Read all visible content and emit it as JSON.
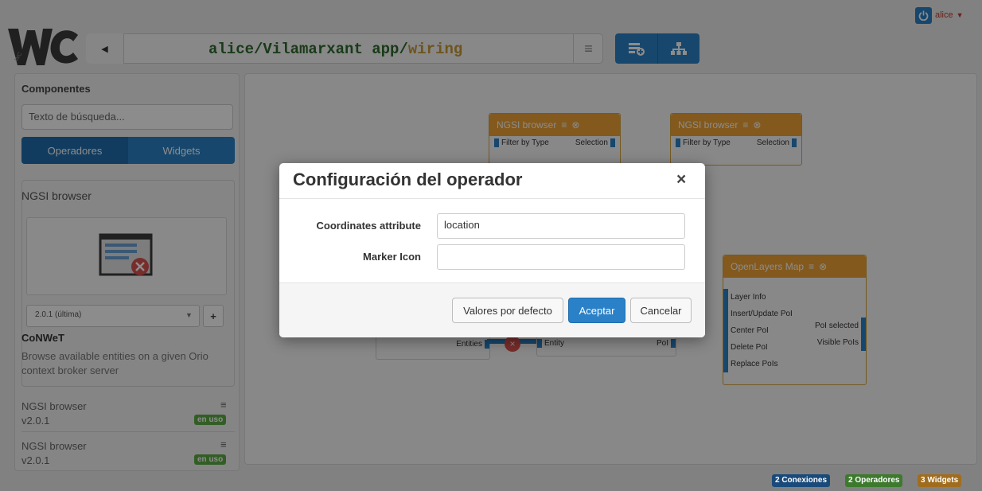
{
  "header": {
    "logo_text": "WC",
    "breadcrumb": {
      "user": "alice",
      "workspace": "Vilamarxant app",
      "view": "wiring",
      "separator": "/"
    },
    "user": {
      "name": "alice"
    }
  },
  "sidebar": {
    "title": "Componentes",
    "search_placeholder": "Texto de búsqueda...",
    "tabs": [
      {
        "label": "Operadores",
        "active": true
      },
      {
        "label": "Widgets",
        "active": false
      }
    ],
    "selected": {
      "name": "NGSI browser",
      "version": "2.0.1 (última)",
      "vendor": "CoNWeT",
      "description": "Browse available entities on a given Orio context broker server"
    },
    "instances": [
      {
        "name": "NGSI browser",
        "version": "v2.0.1",
        "badge": "en uso"
      },
      {
        "name": "NGSI browser",
        "version": "v2.0.1",
        "badge": "en uso"
      }
    ]
  },
  "canvas": {
    "operators": [
      {
        "title": "NGSI browser",
        "inputs": [
          "Filter by Type"
        ],
        "outputs": [
          "Selection"
        ]
      },
      {
        "title": "NGSI browser",
        "inputs": [
          "Filter by Type"
        ],
        "outputs": [
          "Selection"
        ]
      },
      {
        "title": "OpenLayers Map",
        "inputs": [
          "Layer Info",
          "Insert/Update PoI",
          "Center PoI",
          "Delete PoI",
          "Replace PoIs"
        ],
        "outputs": [
          "PoI selected",
          "Visible PoIs"
        ]
      }
    ],
    "fragments": {
      "entities": "Entities",
      "entity": "Entity",
      "poi": "PoI"
    }
  },
  "dialog": {
    "title": "Configuración del operador",
    "close": "×",
    "fields": [
      {
        "label": "Coordinates attribute",
        "value": "location"
      },
      {
        "label": "Marker Icon",
        "value": ""
      }
    ],
    "buttons": {
      "defaults": "Valores por defecto",
      "accept": "Aceptar",
      "cancel": "Cancelar"
    }
  },
  "status": {
    "connections": "2 Conexiones",
    "operators": "2 Operadores",
    "widgets": "3 Widgets"
  },
  "colors": {
    "accent": "#2a81c7",
    "operator": "#eea236",
    "success": "#5cab46",
    "danger": "#c0392b"
  }
}
